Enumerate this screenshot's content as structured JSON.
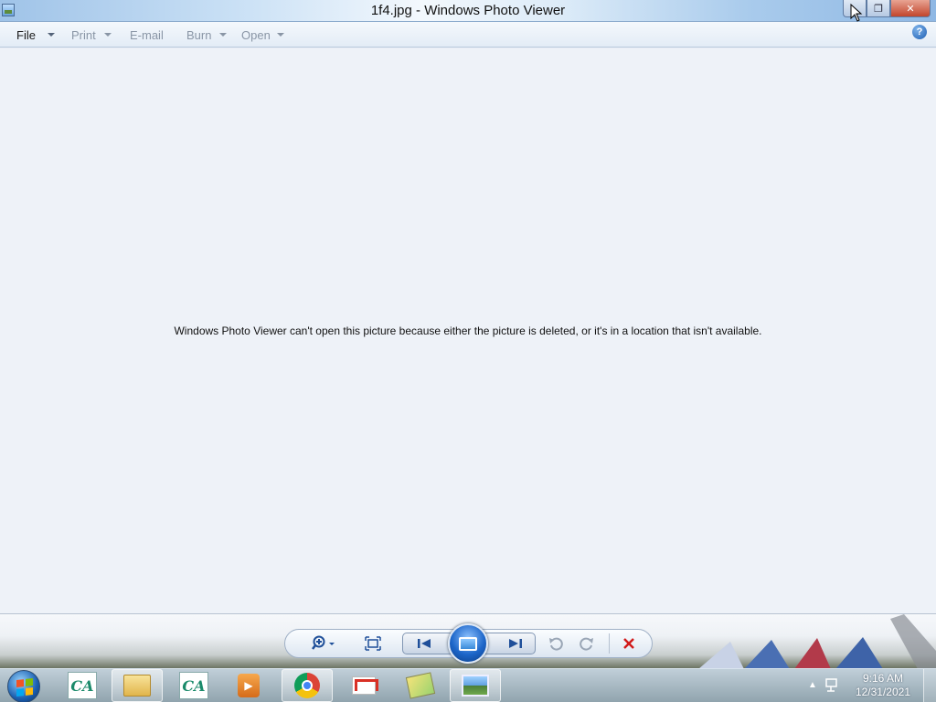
{
  "window": {
    "title": "1f4.jpg - Windows Photo Viewer"
  },
  "menu": {
    "file": "File",
    "print": "Print",
    "email": "E-mail",
    "burn": "Burn",
    "open": "Open",
    "help_icon": "?"
  },
  "content": {
    "message": "Windows Photo Viewer can't open this picture because either the picture is deleted, or it's in a location that isn't available."
  },
  "controls": {
    "zoom": "zoom-icon",
    "actual_size": "actual-size-icon",
    "previous": "previous-icon",
    "slideshow": "slideshow-icon",
    "next": "next-icon",
    "rotate_ccw": "rotate-counterclockwise-icon",
    "rotate_cw": "rotate-clockwise-icon",
    "delete": "delete-icon"
  },
  "taskbar": {
    "ca_logo_1": "CA",
    "ca_logo_2": "CA",
    "time": "9:16 AM",
    "date": "12/31/2021"
  },
  "colors": {
    "content_bg": "#eef2f8",
    "accent": "#1f4f99",
    "delete_red": "#d11a1a"
  }
}
